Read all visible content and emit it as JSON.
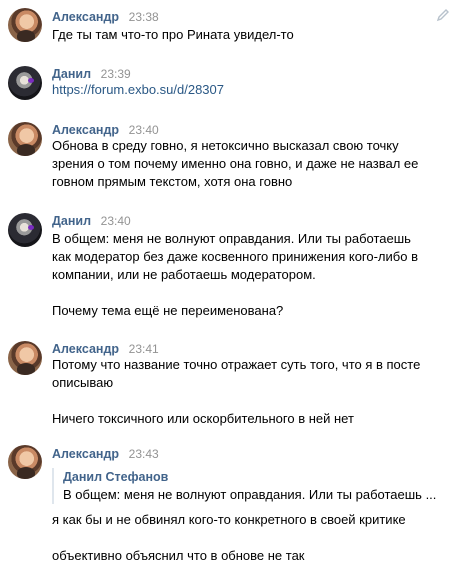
{
  "messages": [
    {
      "author": "Александр",
      "time": "23:38",
      "lines": [
        "Где ты там что-то про Рината увидел-то"
      ]
    },
    {
      "author": "Данил",
      "time": "23:39",
      "link": "https://forum.exbo.su/d/28307"
    },
    {
      "author": "Александр",
      "time": "23:40",
      "lines": [
        "Обнова в среду говно, я нетоксично высказал свою точку",
        "зрения о том почему именно она говно, и даже не назвал ее",
        "говном прямым текстом, хотя она говно"
      ]
    },
    {
      "author": "Данил",
      "time": "23:40",
      "lines": [
        "В общем: меня не волнуют оправдания. Или ты работаешь",
        "как модератор без даже косвенного принижения кого-либо в",
        "компании, или не работаешь модератором."
      ],
      "lines2": [
        "Почему тема ещё не переименована?"
      ]
    },
    {
      "author": "Александр",
      "time": "23:41",
      "lines": [
        "Потому что название точно отражает суть того, что я в посте",
        "описываю"
      ],
      "lines2": [
        "Ничего токсичного или оскорбительного в ней нет"
      ]
    },
    {
      "author": "Александр",
      "time": "23:43",
      "quote": {
        "author": "Данил Стефанов",
        "text": "В общем: меня не волнуют оправдания. Или ты работаешь ..."
      },
      "lines": [
        "я как бы и не обвинял кого-то конкретного в своей критике"
      ],
      "lines2": [
        "объективно объяснил что в обнове не так"
      ]
    }
  ],
  "icons": {
    "edit": "pencil-icon"
  }
}
